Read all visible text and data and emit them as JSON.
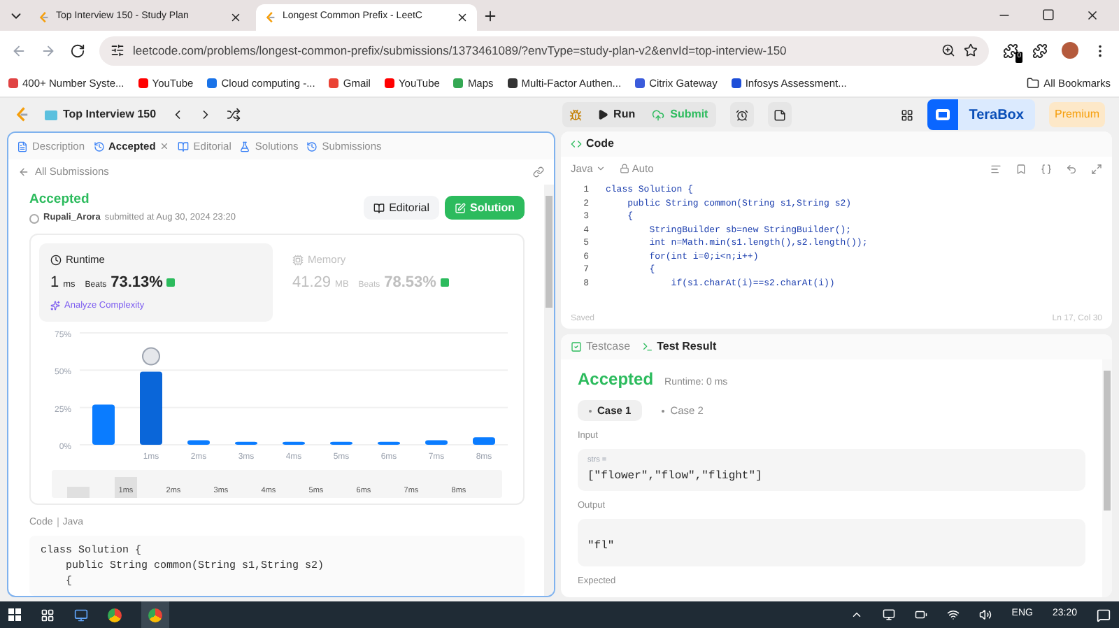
{
  "browser": {
    "tabs": [
      {
        "title": "Top Interview 150 - Study Plan",
        "selected": false
      },
      {
        "title": "Longest Common Prefix - LeetC",
        "selected": true
      }
    ],
    "url": "leetcode.com/problems/longest-common-prefix/submissions/1373461089/?envType=study-plan-v2&envId=top-interview-150",
    "extension_badge": "0",
    "bookmarks": [
      "400+ Number Syste...",
      "YouTube",
      "Cloud computing -...",
      "Gmail",
      "YouTube",
      "Maps",
      "Multi-Factor Authen...",
      "Citrix Gateway",
      "Infosys Assessment..."
    ],
    "all_bookmarks": "All Bookmarks"
  },
  "toolbar": {
    "problem_list": "Top Interview 150",
    "run": "Run",
    "submit": "Submit",
    "terabox": "TeraBox",
    "premium": "Premium"
  },
  "left_panel": {
    "tabs": [
      {
        "label": "Description",
        "selected": false
      },
      {
        "label": "Accepted",
        "selected": true
      },
      {
        "label": "Editorial",
        "selected": false
      },
      {
        "label": "Solutions",
        "selected": false
      },
      {
        "label": "Submissions",
        "selected": false
      }
    ],
    "back": "All Submissions",
    "status": "Accepted",
    "user": "Rupali_Arora",
    "submitted": "submitted at Aug 30, 2024 23:20",
    "editorial_button": "Editorial",
    "solution_button": "Solution",
    "metrics": [
      {
        "label": "Runtime",
        "value": "1",
        "unit": "ms",
        "beats_label": "Beats",
        "beats": "73.13%",
        "selected": true
      },
      {
        "label": "Memory",
        "value": "41.29",
        "unit": "MB",
        "beats_label": "Beats",
        "beats": "78.53%",
        "selected": false
      }
    ],
    "analyze": "Analyze Complexity",
    "chart_data": {
      "type": "bar",
      "categories": [
        null,
        "1ms",
        "2ms",
        "3ms",
        "4ms",
        "5ms",
        "6ms",
        "7ms",
        "8ms"
      ],
      "values": [
        27,
        49,
        3,
        2,
        2,
        2,
        2,
        3,
        5
      ],
      "ylim": [
        0,
        75
      ],
      "yticks": [
        {
          "value": 0,
          "label": "0%"
        },
        {
          "value": 25,
          "label": "25%"
        },
        {
          "value": 50,
          "label": "50%"
        },
        {
          "value": 75,
          "label": "75%"
        }
      ]
    },
    "range_labels": [
      "1ms",
      "2ms",
      "3ms",
      "4ms",
      "5ms",
      "6ms",
      "7ms",
      "8ms"
    ],
    "code_label": "Code",
    "code_language": "Java",
    "code_lines": [
      "class Solution {",
      "    public String common(String s1,String s2)",
      "    {"
    ]
  },
  "editor": {
    "title": "Code",
    "language": "Java",
    "mode": "Auto",
    "lines": [
      "class Solution {",
      "    public String common(String s1,String s2)",
      "    {",
      "        StringBuilder sb=new StringBuilder();",
      "        int n=Math.min(s1.length(),s2.length());",
      "        for(int i=0;i<n;i++)",
      "        {",
      "            if(s1.charAt(i)==s2.charAt(i))"
    ],
    "line_numbers": [
      "1",
      "2",
      "3",
      "4",
      "5",
      "6",
      "7",
      "8"
    ],
    "saved": "Saved",
    "cursor": "Ln 17, Col 30"
  },
  "test_panel": {
    "tabs": [
      {
        "label": "Testcase",
        "selected": false
      },
      {
        "label": "Test Result",
        "selected": true
      }
    ],
    "status": "Accepted",
    "runtime": "Runtime: 0 ms",
    "cases": [
      {
        "label": "Case 1",
        "selected": true
      },
      {
        "label": "Case 2",
        "selected": false
      }
    ],
    "input_label": "Input",
    "variable": "strs =",
    "input_value": "[\"flower\",\"flow\",\"flight\"]",
    "output_label": "Output",
    "output_value": "\"fl\"",
    "expected_label": "Expected"
  },
  "taskbar": {
    "language": "ENG",
    "time": "23:20"
  }
}
